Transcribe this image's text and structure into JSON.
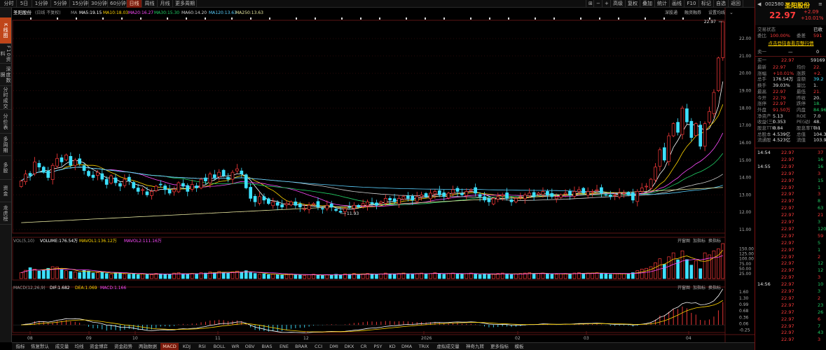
{
  "top_tabs": [
    {
      "label": "分时",
      "active": false
    },
    {
      "label": "5日",
      "active": false
    },
    {
      "label": "1分钟",
      "active": false
    },
    {
      "label": "5分钟",
      "active": false
    },
    {
      "label": "15分钟",
      "active": false
    },
    {
      "label": "30分钟",
      "active": false
    },
    {
      "label": "60分钟",
      "active": false
    },
    {
      "label": "日线",
      "active": true
    },
    {
      "label": "周线",
      "active": false
    },
    {
      "label": "月线",
      "active": false
    },
    {
      "label": "更多周期",
      "active": false
    }
  ],
  "top_right": [
    "高级",
    "复权",
    "叠加",
    "统计",
    "画线",
    "F10",
    "标记",
    "自选",
    "返回"
  ],
  "left_nav": [
    {
      "label": "K线图",
      "active": true
    },
    {
      "label": "F10资料",
      "active": false
    },
    {
      "label": "深度数据",
      "active": false
    },
    {
      "label": "分时成交",
      "active": false
    },
    {
      "label": "分价表",
      "active": false
    },
    {
      "label": "多周期",
      "active": false
    },
    {
      "label": "多股",
      "active": false
    },
    {
      "label": "资金",
      "active": false
    },
    {
      "label": "龙虎榜",
      "active": false
    }
  ],
  "main": {
    "stock_name": "圣阳股份",
    "fuquan": "(日线 不复权)",
    "ma_title": "MA",
    "ma": [
      {
        "label": "MA5:19.15",
        "color": "#ffffff"
      },
      {
        "label": "MA10:18.03",
        "color": "#ffd400"
      },
      {
        "label": "MA20:16.27",
        "color": "#ff4cff"
      },
      {
        "label": "MA30:15.30",
        "color": "#22d066"
      },
      {
        "label": "MA60:14.20",
        "color": "#d0d0d0"
      },
      {
        "label": "MA120:13.63",
        "color": "#5ad0ff"
      },
      {
        "label": "MA250:13.63",
        "color": "#e8e8a0"
      }
    ],
    "toolbar": [
      "深股通",
      "融资融券",
      "设置均线"
    ],
    "price_ticks": [
      "22.00",
      "21.00",
      "20.00",
      "19.00",
      "18.00",
      "17.00",
      "16.00",
      "15.00",
      "14.00",
      "13.00",
      "12.00",
      "11.00"
    ],
    "high_label": "22.97",
    "low_label": "11.93",
    "vol": {
      "title": "VOL(5,10)",
      "volume": "VOLUME:176.54万",
      "mavol1": "MAVOL1:136.12万",
      "mavol2": "MAVOL2:111.16万",
      "ticks": [
        "150.00",
        "125.00",
        "100.00",
        "75.00",
        "50.00",
        "25.00"
      ],
      "tools": [
        "开窗图",
        "加指标",
        "换指标"
      ]
    },
    "macd": {
      "title": "MACD(12,26,9)",
      "dif": "DIF:1.682",
      "dea": "DEA:1.069",
      "macd": "MACD:1.166",
      "ticks": [
        "1.60",
        "1.30",
        "0.99",
        "0.68",
        "0.36",
        "0.06",
        "-0.25"
      ],
      "tools": [
        "开窗图",
        "加指标",
        "换指标"
      ]
    },
    "date_labels": [
      "08",
      "09",
      "10",
      "11",
      "12",
      "2026",
      "02",
      "03",
      "04"
    ]
  },
  "chart_data": {
    "type": "candlestick",
    "series_name": "圣阳股份",
    "y_range": [
      10.8,
      22.97
    ],
    "high": 22.97,
    "low": 11.93,
    "closes": [
      13.8,
      14.2,
      14.1,
      14.9,
      14.6,
      14.3,
      14.0,
      14.7,
      15.1,
      14.9,
      15.3,
      14.7,
      15.0,
      14.8,
      14.4,
      14.1,
      14.0,
      14.3,
      13.9,
      13.6,
      14.1,
      13.7,
      13.5,
      13.9,
      13.8,
      13.4,
      13.2,
      13.3,
      13.0,
      13.2,
      13.5,
      13.6,
      13.3,
      13.1,
      13.3,
      13.7,
      13.5,
      13.2,
      13.6,
      13.4,
      13.9,
      13.8,
      14.2,
      14.0,
      14.3,
      14.1,
      13.9,
      14.3,
      14.5,
      14.2,
      13.4,
      12.8,
      12.6,
      12.9,
      12.7,
      12.5,
      12.6,
      12.4,
      12.3,
      12.5,
      12.6,
      12.4,
      12.3,
      12.2,
      12.4,
      12.5,
      12.3,
      12.2,
      12.4,
      12.3,
      12.1,
      12.0,
      12.2,
      12.3,
      12.4,
      12.3,
      12.5,
      12.6,
      12.5,
      12.4,
      12.6,
      12.8,
      12.7,
      12.6,
      12.8,
      12.9,
      12.8,
      12.7,
      12.9,
      13.0,
      12.9,
      13.1,
      13.2,
      13.0,
      12.9,
      13.1,
      13.3,
      13.2,
      13.0,
      13.2,
      13.3,
      13.1,
      12.9,
      12.7,
      12.6,
      12.8,
      12.9,
      13.0,
      12.8,
      12.6,
      12.8,
      12.9,
      13.0,
      13.1,
      12.9,
      13.1,
      13.2,
      13.0,
      12.9,
      12.9,
      13.0,
      13.1,
      13.0,
      13.2,
      13.3,
      13.1,
      13.2,
      13.2,
      13.3,
      13.1,
      13.0,
      12.9,
      13.0,
      13.1,
      13.1,
      13.0,
      12.7,
      13.2,
      13.4,
      13.5,
      13.9,
      14.6,
      15.6,
      15.0,
      16.4,
      17.1,
      16.6,
      18.0,
      17.2,
      16.3,
      17.1,
      15.8,
      17.1,
      17.8,
      18.9,
      20.88,
      22.97
    ],
    "volumes": [
      30,
      42,
      55,
      48,
      38,
      44,
      52,
      60,
      58,
      45,
      40,
      36,
      34,
      30,
      42,
      38,
      28,
      30,
      34,
      26,
      22,
      30,
      28,
      24,
      22,
      26,
      20,
      24,
      22,
      20,
      26,
      24,
      22,
      20,
      28,
      30,
      24,
      22,
      26,
      24,
      30,
      28,
      34,
      30,
      36,
      32,
      28,
      34,
      38,
      32,
      40,
      30,
      26,
      22,
      24,
      20,
      22,
      20,
      18,
      22,
      24,
      20,
      18,
      16,
      20,
      22,
      18,
      16,
      20,
      18,
      22,
      20,
      24,
      22,
      26,
      20,
      24,
      26,
      22,
      20,
      24,
      28,
      24,
      22,
      26,
      28,
      24,
      22,
      26,
      28,
      24,
      26,
      30,
      24,
      22,
      26,
      28,
      24,
      22,
      26,
      28,
      24,
      20,
      22,
      20,
      24,
      26,
      28,
      22,
      20,
      24,
      26,
      28,
      30,
      24,
      26,
      28,
      24,
      22,
      22,
      24,
      26,
      24,
      28,
      30,
      26,
      28,
      28,
      30,
      26,
      24,
      22,
      24,
      26,
      26,
      24,
      30,
      40,
      48,
      52,
      60,
      80,
      100,
      72,
      110,
      130,
      95,
      140,
      96,
      68,
      90,
      50,
      130,
      120,
      140,
      150,
      176.54
    ],
    "ma_series": [
      "MA5",
      "MA10",
      "MA20",
      "MA30",
      "MA60",
      "MA120",
      "MA250"
    ],
    "volume_unit": "万"
  },
  "right": {
    "code": "002580",
    "name": "圣阳股份",
    "price": "22.97",
    "change": "+2.09",
    "change_pct": "+10.01%",
    "status_label": "交易状态",
    "status_value": "已收",
    "weibi": {
      "label": "委比",
      "value": "100.00%",
      "label2": "委差",
      "value2": "591"
    },
    "link": "点击登陆查看完整行情",
    "sell1": {
      "label": "卖一",
      "price": "—",
      "vol": "0"
    },
    "buy1": {
      "label": "买一",
      "price": "22.97",
      "vol": "59169"
    },
    "stats": [
      {
        "l1": "最新",
        "v1": "22.97",
        "c1": "red",
        "l2": "均价",
        "v2": "22.",
        "c2": "red"
      },
      {
        "l1": "涨幅",
        "v1": "+10.01%",
        "c1": "red",
        "l2": "涨跌",
        "v2": "+2.",
        "c2": "red"
      },
      {
        "l1": "总手",
        "v1": "176.54万",
        "c1": "white",
        "l2": "金额",
        "v2": "39.2",
        "c2": "cyan"
      },
      {
        "l1": "换手",
        "v1": "39.03%",
        "c1": "white",
        "l2": "量比",
        "v2": "1.",
        "c2": "white"
      },
      {
        "l1": "最高",
        "v1": "22.97",
        "c1": "red",
        "l2": "最低",
        "v2": "21.",
        "c2": "red"
      },
      {
        "l1": "今开",
        "v1": "22.79",
        "c1": "red",
        "l2": "昨收",
        "v2": "20.",
        "c2": "white"
      },
      {
        "l1": "涨停",
        "v1": "22.97",
        "c1": "red",
        "l2": "跌停",
        "v2": "18.",
        "c2": "green"
      },
      {
        "l1": "外盘",
        "v1": "91.50万",
        "c1": "red",
        "l2": "内盘",
        "v2": "84.96",
        "c2": "green"
      },
      {
        "l1": "净资产",
        "v1": "5.13",
        "c1": "white",
        "l2": "ROE",
        "v2": "7.0",
        "c2": "white"
      },
      {
        "l1": "收益(三)",
        "v1": "0.353",
        "c1": "white",
        "l2": "PE(动)",
        "v2": "48.",
        "c2": "white"
      },
      {
        "l1": "股息TTM",
        "v1": "0.84",
        "c1": "white",
        "l2": "股息率TTM",
        "v2": "0.1",
        "c2": "white"
      },
      {
        "l1": "总股本",
        "v1": "4.539亿",
        "c1": "white",
        "l2": "总值",
        "v2": "104.3",
        "c2": "white"
      },
      {
        "l1": "流通股",
        "v1": "4.523亿",
        "c1": "white",
        "l2": "流值",
        "v2": "103.9",
        "c2": "white"
      }
    ],
    "trades": [
      {
        "t": "14:54",
        "p": "22.97",
        "v": "37",
        "d": ""
      },
      {
        "t": "",
        "p": "22.97",
        "v": "16",
        "d": ""
      },
      {
        "t": "14:55",
        "p": "22.97",
        "v": "16",
        "d": ""
      },
      {
        "t": "",
        "p": "22.97",
        "v": "3",
        "d": ""
      },
      {
        "t": "",
        "p": "22.97",
        "v": "15",
        "d": ""
      },
      {
        "t": "",
        "p": "22.97",
        "v": "1",
        "d": ""
      },
      {
        "t": "",
        "p": "22.97",
        "v": "3",
        "d": ""
      },
      {
        "t": "",
        "p": "22.97",
        "v": "8",
        "d": ""
      },
      {
        "t": "",
        "p": "22.97",
        "v": "63",
        "d": ""
      },
      {
        "t": "",
        "p": "22.97",
        "v": "21",
        "d": ""
      },
      {
        "t": "",
        "p": "22.97",
        "v": "3",
        "d": ""
      },
      {
        "t": "",
        "p": "22.97",
        "v": "120",
        "d": ""
      },
      {
        "t": "",
        "p": "22.97",
        "v": "59",
        "d": ""
      },
      {
        "t": "",
        "p": "22.97",
        "v": "5",
        "d": ""
      },
      {
        "t": "",
        "p": "22.97",
        "v": "1",
        "d": ""
      },
      {
        "t": "",
        "p": "22.97",
        "v": "2",
        "d": ""
      },
      {
        "t": "",
        "p": "22.97",
        "v": "12",
        "d": ""
      },
      {
        "t": "",
        "p": "22.97",
        "v": "12",
        "d": ""
      },
      {
        "t": "",
        "p": "22.97",
        "v": "3",
        "d": ""
      },
      {
        "t": "14:56",
        "p": "22.97",
        "v": "10",
        "d": ""
      },
      {
        "t": "",
        "p": "22.97",
        "v": "3",
        "d": ""
      },
      {
        "t": "",
        "p": "22.97",
        "v": "2",
        "d": ""
      },
      {
        "t": "",
        "p": "22.97",
        "v": "23",
        "d": ""
      },
      {
        "t": "",
        "p": "22.97",
        "v": "26",
        "d": ""
      },
      {
        "t": "",
        "p": "22.97",
        "v": "6",
        "d": ""
      },
      {
        "t": "",
        "p": "22.97",
        "v": "7",
        "d": ""
      },
      {
        "t": "",
        "p": "22.97",
        "v": "43",
        "d": ""
      },
      {
        "t": "",
        "p": "22.97",
        "v": "3",
        "d": ""
      }
    ]
  },
  "bottom_tabs": [
    {
      "label": "指标",
      "active": false
    },
    {
      "label": "恢复默认",
      "active": false
    },
    {
      "label": "成交量",
      "active": false
    },
    {
      "label": "均线",
      "active": false
    },
    {
      "label": "资金博弈",
      "active": false
    },
    {
      "label": "资金趋势",
      "active": false
    },
    {
      "label": "两融数据",
      "active": false
    },
    {
      "label": "MACD",
      "active": true
    },
    {
      "label": "KDJ",
      "active": false
    },
    {
      "label": "RSI",
      "active": false
    },
    {
      "label": "BOLL",
      "active": false
    },
    {
      "label": "WR",
      "active": false
    },
    {
      "label": "OBV",
      "active": false
    },
    {
      "label": "BIAS",
      "active": false
    },
    {
      "label": "ENE",
      "active": false
    },
    {
      "label": "BRAR",
      "active": false
    },
    {
      "label": "CCI",
      "active": false
    },
    {
      "label": "DMI",
      "active": false
    },
    {
      "label": "DKX",
      "active": false
    },
    {
      "label": "CR",
      "active": false
    },
    {
      "label": "PSY",
      "active": false
    },
    {
      "label": "KD",
      "active": false
    },
    {
      "label": "DMA",
      "active": false
    },
    {
      "label": "TRIX",
      "active": false
    },
    {
      "label": "虚拟成交量",
      "active": false
    },
    {
      "label": "神奇九转",
      "active": false
    },
    {
      "label": "更多指标",
      "active": false
    },
    {
      "label": "模板",
      "active": false
    }
  ],
  "colors": {
    "up": "#ff3b3b",
    "down": "#3ce0ff",
    "grid": "#3a0e0e",
    "accent": "#c0461a"
  }
}
